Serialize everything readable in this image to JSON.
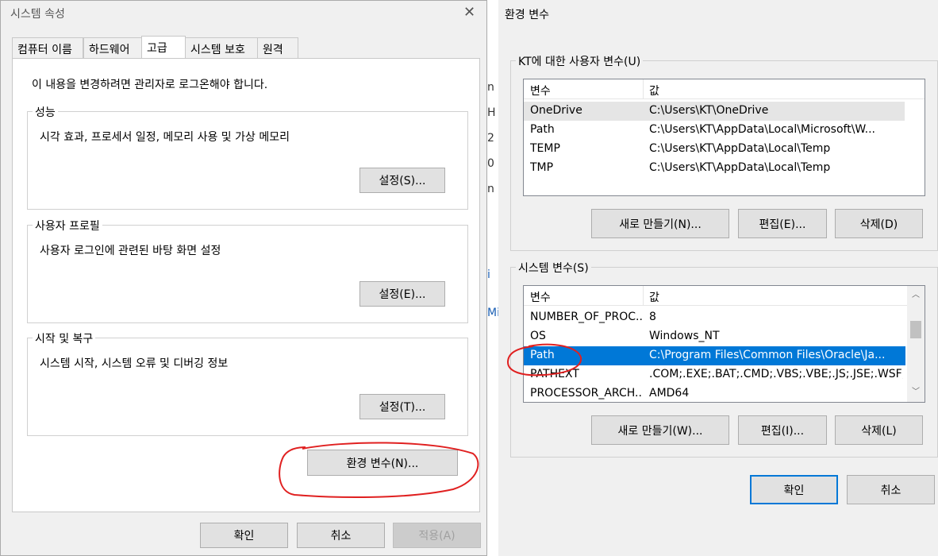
{
  "left": {
    "title": "시스템 속성",
    "tabs": [
      "컴퓨터 이름",
      "하드웨어",
      "고급",
      "시스템 보호",
      "원격"
    ],
    "admin_note": "이 내용을 변경하려면 관리자로 로그온해야 합니다.",
    "performance": {
      "legend": "성능",
      "desc": "시각 효과, 프로세서 일정, 메모리 사용 및 가상 메모리",
      "button": "설정(S)..."
    },
    "profile": {
      "legend": "사용자 프로필",
      "desc": "사용자 로그인에 관련된 바탕 화면 설정",
      "button": "설정(E)..."
    },
    "startup": {
      "legend": "시작 및 복구",
      "desc": "시스템 시작, 시스템 오류 및 디버깅 정보",
      "button": "설정(T)..."
    },
    "env_button": "환경 변수(N)...",
    "ok": "확인",
    "cancel": "취소",
    "apply": "적용(A)"
  },
  "right": {
    "title": "환경 변수",
    "user_vars": {
      "legend": "KT에 대한 사용자 변수(U)",
      "col_var": "변수",
      "col_val": "값",
      "rows": [
        {
          "name": "OneDrive",
          "value": "C:\\Users\\KT\\OneDrive"
        },
        {
          "name": "Path",
          "value": "C:\\Users\\KT\\AppData\\Local\\Microsoft\\W..."
        },
        {
          "name": "TEMP",
          "value": "C:\\Users\\KT\\AppData\\Local\\Temp"
        },
        {
          "name": "TMP",
          "value": "C:\\Users\\KT\\AppData\\Local\\Temp"
        }
      ],
      "new": "새로 만들기(N)...",
      "edit": "편집(E)...",
      "delete": "삭제(D)"
    },
    "sys_vars": {
      "legend": "시스템 변수(S)",
      "col_var": "변수",
      "col_val": "값",
      "rows": [
        {
          "name": "NUMBER_OF_PROC...",
          "value": "8"
        },
        {
          "name": "OS",
          "value": "Windows_NT"
        },
        {
          "name": "Path",
          "value": "C:\\Program Files\\Common Files\\Oracle\\Ja..."
        },
        {
          "name": "PATHEXT",
          "value": ".COM;.EXE;.BAT;.CMD;.VBS;.VBE;.JS;.JSE;.WSF;..."
        },
        {
          "name": "PROCESSOR_ARCH...",
          "value": "AMD64"
        }
      ],
      "new": "새로 만들기(W)...",
      "edit": "편집(I)...",
      "delete": "삭제(L)"
    },
    "ok": "확인",
    "cancel": "취소"
  },
  "background_fragments": [
    "n",
    "H",
    "2",
    "0",
    "n",
    "i",
    "Mi"
  ],
  "colors": {
    "accent": "#0078d7",
    "annotation": "#e02020"
  },
  "icons": {
    "close": "close-icon",
    "scroll_up": "chevron-up-icon",
    "scroll_down": "chevron-down-icon"
  }
}
